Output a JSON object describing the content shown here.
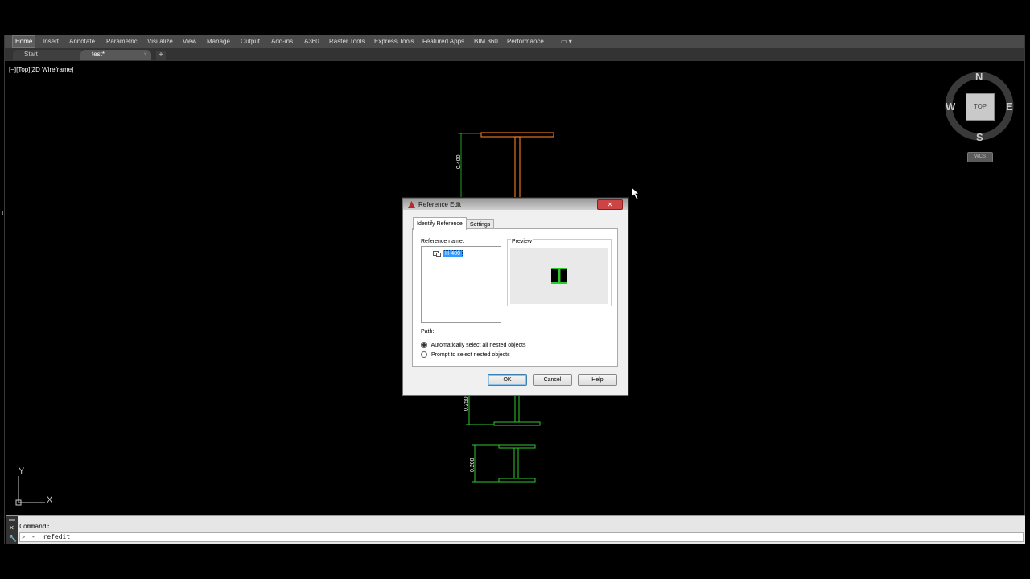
{
  "ribbon": {
    "tabs": [
      "Home",
      "Insert",
      "Annotate",
      "Parametric",
      "Visualize",
      "View",
      "Manage",
      "Output",
      "Add-ins",
      "A360",
      "Raster Tools",
      "Express Tools",
      "Featured Apps",
      "BIM 360",
      "Performance"
    ],
    "active_tab": "Home"
  },
  "file_tabs": {
    "items": [
      {
        "label": "Start"
      },
      {
        "label": "test*"
      }
    ],
    "new_tab_symbol": "+",
    "close_symbol": "×"
  },
  "viewport": {
    "label": "[−][Top][2D Wireframe]",
    "dimensions": {
      "top": "0.400",
      "middle": "0.250",
      "bottom": "0.200"
    },
    "ucs": {
      "x": "X",
      "y": "Y"
    }
  },
  "viewcube": {
    "north": "N",
    "south": "S",
    "east": "E",
    "west": "W",
    "face": "TOP",
    "wcs": "WCS"
  },
  "command": {
    "history": "Command:",
    "input": "- _refedit",
    "prompt_icon": ">_"
  },
  "dialog": {
    "title": "Reference Edit",
    "close_symbol": "✕",
    "tabs": [
      "Identify Reference",
      "Settings"
    ],
    "reference_name_label": "Reference name:",
    "reference_item": "H-400",
    "preview_label": "Preview",
    "path_label": "Path:",
    "options": [
      {
        "label": "Automatically select all nested objects",
        "selected": true
      },
      {
        "label": "Prompt to select nested objects",
        "selected": false
      }
    ],
    "buttons": {
      "ok": "OK",
      "cancel": "Cancel",
      "help": "Help"
    }
  },
  "colors": {
    "canvas": "#000000",
    "orange_block": "#e0731f",
    "green_block": "#2ec82e",
    "selection": "#3399ff"
  }
}
